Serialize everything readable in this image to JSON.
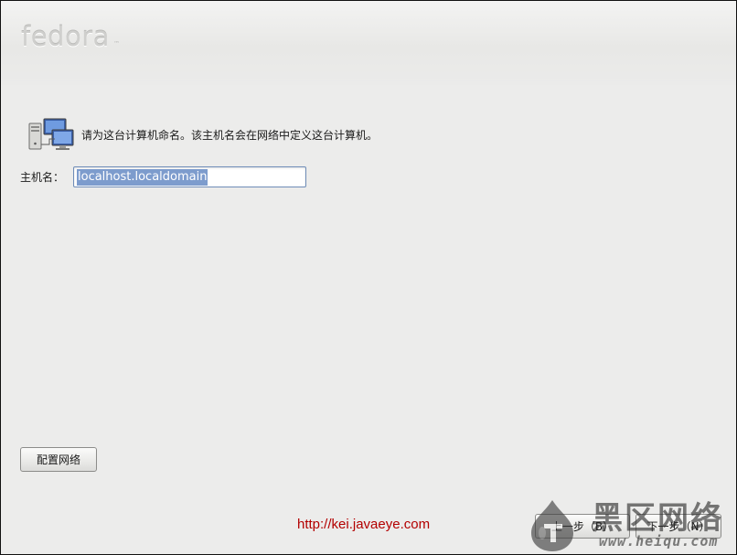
{
  "brand": {
    "logo_text": "fedora",
    "logo_tm": "™"
  },
  "hostname_page": {
    "intro_text": "请为这台计算机命名。该主机名会在网络中定义这台计算机。",
    "hostname_label": "主机名：",
    "hostname_value": "localhost.localdomain"
  },
  "buttons": {
    "configure_network": "配置网络",
    "back": "上一步（B）",
    "next": "下一步（N）"
  },
  "footer": {
    "url": "http://kei.javaeye.com"
  },
  "watermark": {
    "site_name": "黑区网络",
    "domain": "www.heiqu.com"
  },
  "colors": {
    "background": "#ececeb",
    "selection": "#7d9ccd",
    "input_border": "#6f8db8",
    "footer_url": "#b30000"
  },
  "icons": {
    "intro": "network-computers-icon"
  }
}
